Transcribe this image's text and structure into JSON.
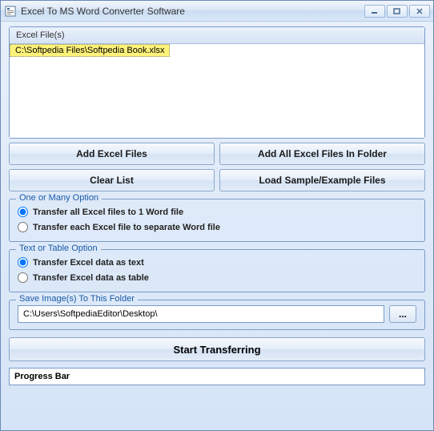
{
  "window": {
    "title": "Excel To MS Word Converter Software"
  },
  "filePanel": {
    "header": "Excel File(s)",
    "items": [
      "C:\\Softpedia Files\\Softpedia Book.xlsx"
    ]
  },
  "buttons": {
    "addFiles": "Add Excel Files",
    "addFolder": "Add All Excel Files In Folder",
    "clearList": "Clear List",
    "loadSample": "Load Sample/Example Files",
    "browse": "...",
    "start": "Start Transferring"
  },
  "options": {
    "oneOrMany": {
      "title": "One or Many Option",
      "opt1": "Transfer all Excel files to 1 Word file",
      "opt2": "Transfer each Excel file to separate Word file"
    },
    "textOrTable": {
      "title": "Text or Table Option",
      "opt1": "Transfer Excel data as text",
      "opt2": "Transfer Excel data as table"
    }
  },
  "savePath": {
    "title": "Save Image(s) To This Folder",
    "value": "C:\\Users\\SoftpediaEditor\\Desktop\\"
  },
  "progress": {
    "label": "Progress Bar"
  }
}
